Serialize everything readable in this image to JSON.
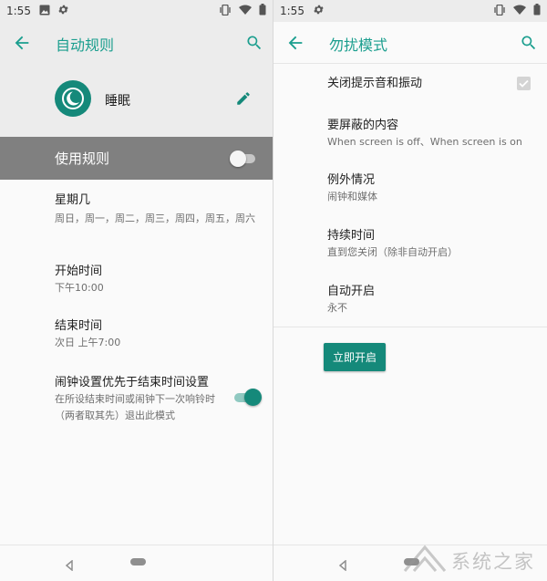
{
  "left_screen": {
    "status": {
      "time": "1:55"
    },
    "appbar": {
      "title": "自动规则"
    },
    "rule": {
      "name": "睡眠"
    },
    "use_rule": {
      "label": "使用规则",
      "enabled": false
    },
    "settings": [
      {
        "title": "星期几",
        "subtitle": "周日，周一，周二，周三，周四，周五，周六"
      },
      {
        "title": "开始时间",
        "subtitle": "下午10:00"
      },
      {
        "title": "结束时间",
        "subtitle": "次日 上午7:00"
      },
      {
        "title": "闹钟设置优先于结束时间设置",
        "subtitle": "在所设结束时间或闹钟下一次响铃时（两者取其先）退出此模式",
        "enabled": true
      }
    ]
  },
  "right_screen": {
    "status": {
      "time": "1:55"
    },
    "appbar": {
      "title": "勿扰模式"
    },
    "settings": [
      {
        "title": "关闭提示音和振动",
        "checked": true
      },
      {
        "title": "要屏蔽的内容",
        "subtitle": "When screen is off、When screen is on"
      },
      {
        "title": "例外情况",
        "subtitle": "闹钟和媒体"
      },
      {
        "title": "持续时间",
        "subtitle": "直到您关闭（除非自动开启）"
      },
      {
        "title": "自动开启",
        "subtitle": "永不"
      }
    ],
    "button": {
      "label": "立即开启"
    }
  },
  "watermark": {
    "text": "系统之家"
  },
  "colors": {
    "accent": "#15897a",
    "title": "#1a9e8e",
    "selected_bg": "#808080"
  }
}
